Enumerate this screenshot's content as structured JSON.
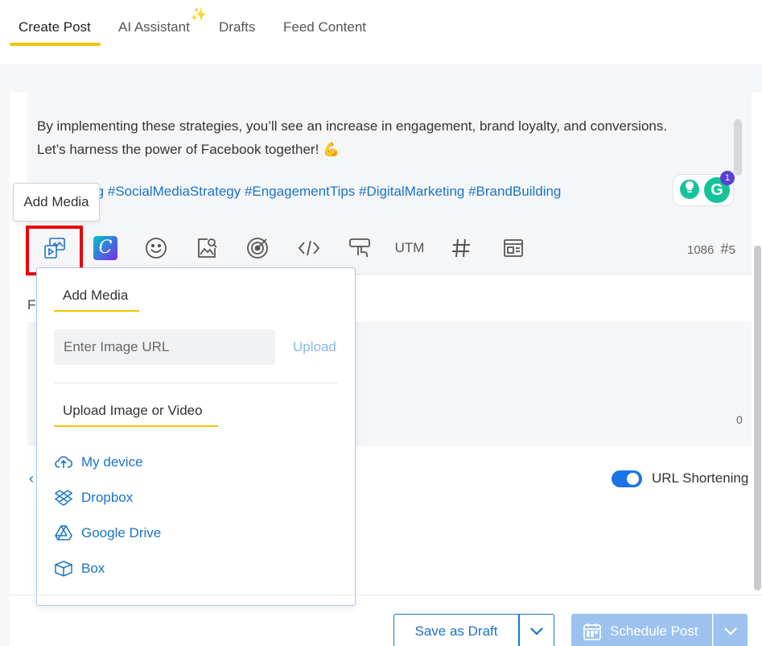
{
  "tabs": [
    {
      "label": "Create Post",
      "active": true
    },
    {
      "label": "AI Assistant",
      "active": false
    },
    {
      "label": "Drafts",
      "active": false
    },
    {
      "label": "Feed Content",
      "active": false
    }
  ],
  "editor": {
    "text_line1": "By implementing these strategies, you’ll see an increase in engagement, brand loyalty, and conversions.",
    "text_line2": "Let’s harness the power of Facebook together! 💪",
    "hashtags": "kMarketing #SocialMediaStrategy #EngagementTips #DigitalMarketing #BrandBuilding",
    "grammarly_badge": "1",
    "char_count": "1086",
    "hashtag_count": "5"
  },
  "tooltip": {
    "text": "Add Media"
  },
  "toolbar": {
    "icons": [
      "add-media-icon",
      "canva-icon",
      "emoji-icon",
      "image-search-icon",
      "target-icon",
      "code-icon",
      "cta-icon",
      "utm",
      "hashtag-icon",
      "preview-icon"
    ],
    "canva_letter": "C",
    "utm_label": "UTM"
  },
  "second_field": {
    "label_partial": "Fa",
    "count": "0"
  },
  "url_shortening": {
    "label": "URL Shortening",
    "enabled": true
  },
  "media_panel": {
    "heading1": "Add Media",
    "url_placeholder": "Enter Image URL",
    "upload_label": "Upload",
    "heading2": "Upload Image or Video",
    "sources": [
      {
        "label": "My device",
        "icon": "cloud-upload-icon"
      },
      {
        "label": "Dropbox",
        "icon": "dropbox-icon"
      },
      {
        "label": "Google Drive",
        "icon": "google-drive-icon"
      },
      {
        "label": "Box",
        "icon": "box-icon"
      }
    ]
  },
  "footer": {
    "save_draft_label": "Save as Draft",
    "schedule_label": "Schedule Post"
  },
  "colors": {
    "accent_yellow": "#f5c400",
    "link_blue": "#1a73c8",
    "highlight_red": "#e8000b",
    "schedule_disabled": "#9dc2ef"
  }
}
